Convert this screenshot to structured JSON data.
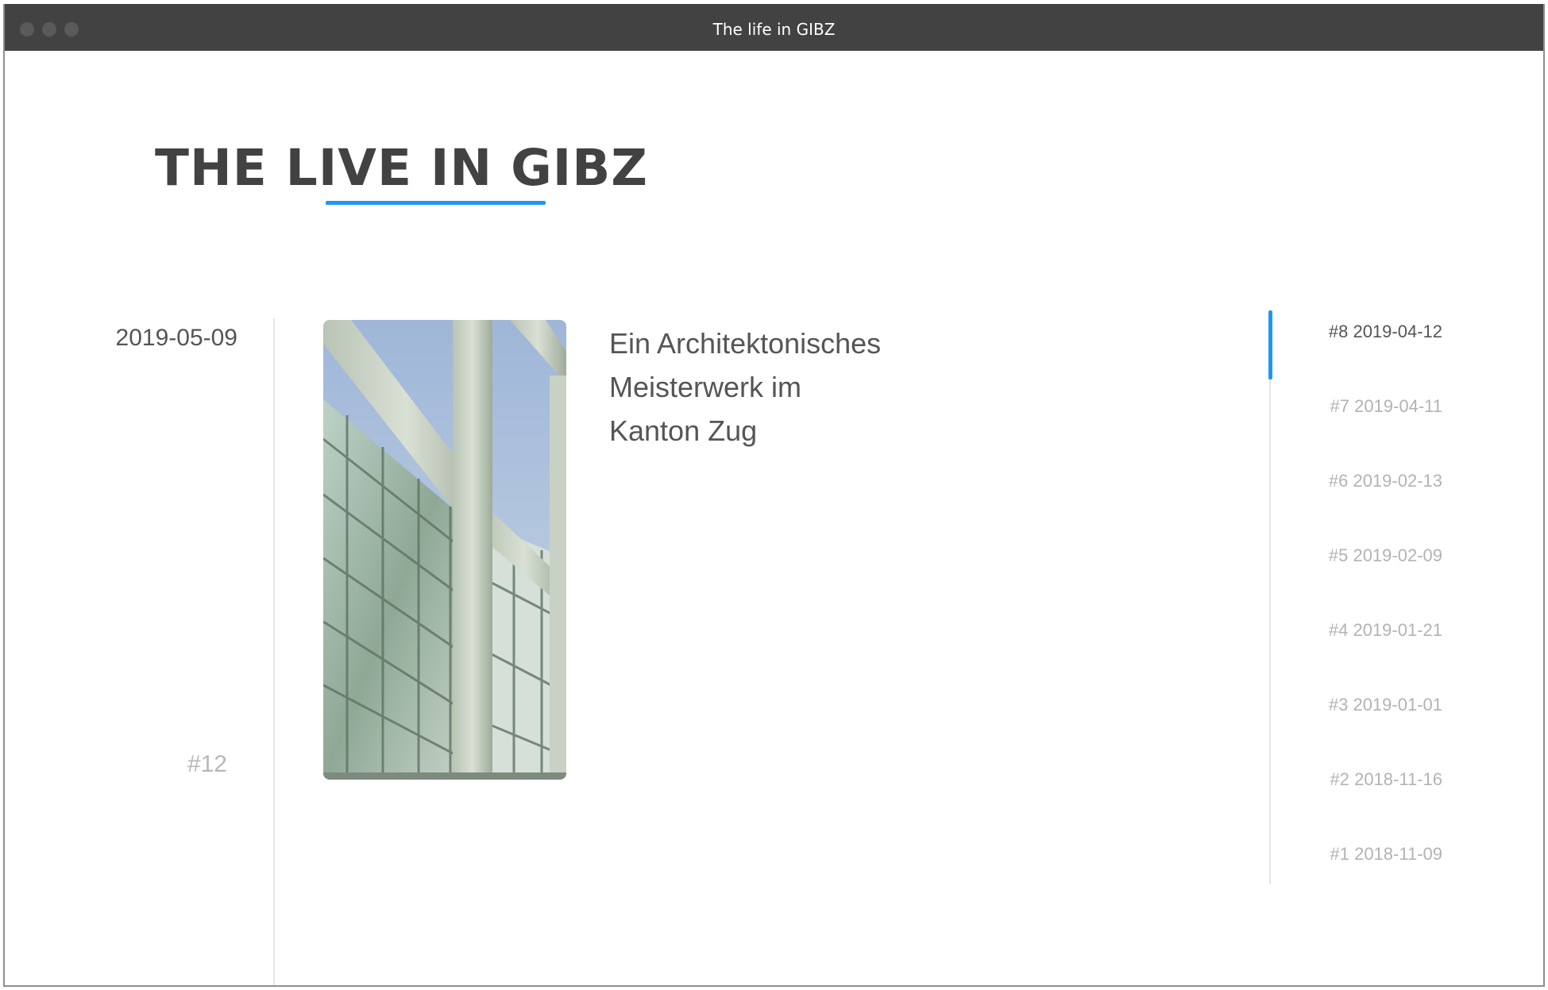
{
  "window": {
    "title": "The life in GIBZ"
  },
  "page": {
    "title": "THE LIVE IN GIBZ"
  },
  "post": {
    "date": "2019-05-09",
    "number": "#12",
    "title_lines": [
      "Ein Architektonisches",
      "Meisterwerk im",
      "Kanton Zug"
    ]
  },
  "nav": {
    "accent_color": "#2196f3",
    "active_index": 0,
    "items": [
      {
        "label": "#8 2019-04-12"
      },
      {
        "label": "#7 2019-04-11"
      },
      {
        "label": "#6 2019-02-13"
      },
      {
        "label": "#5 2019-02-09"
      },
      {
        "label": "#4 2019-01-21"
      },
      {
        "label": "#3 2019-01-01"
      },
      {
        "label": "#2 2018-11-16"
      },
      {
        "label": "#1 2018-11-09"
      }
    ]
  }
}
